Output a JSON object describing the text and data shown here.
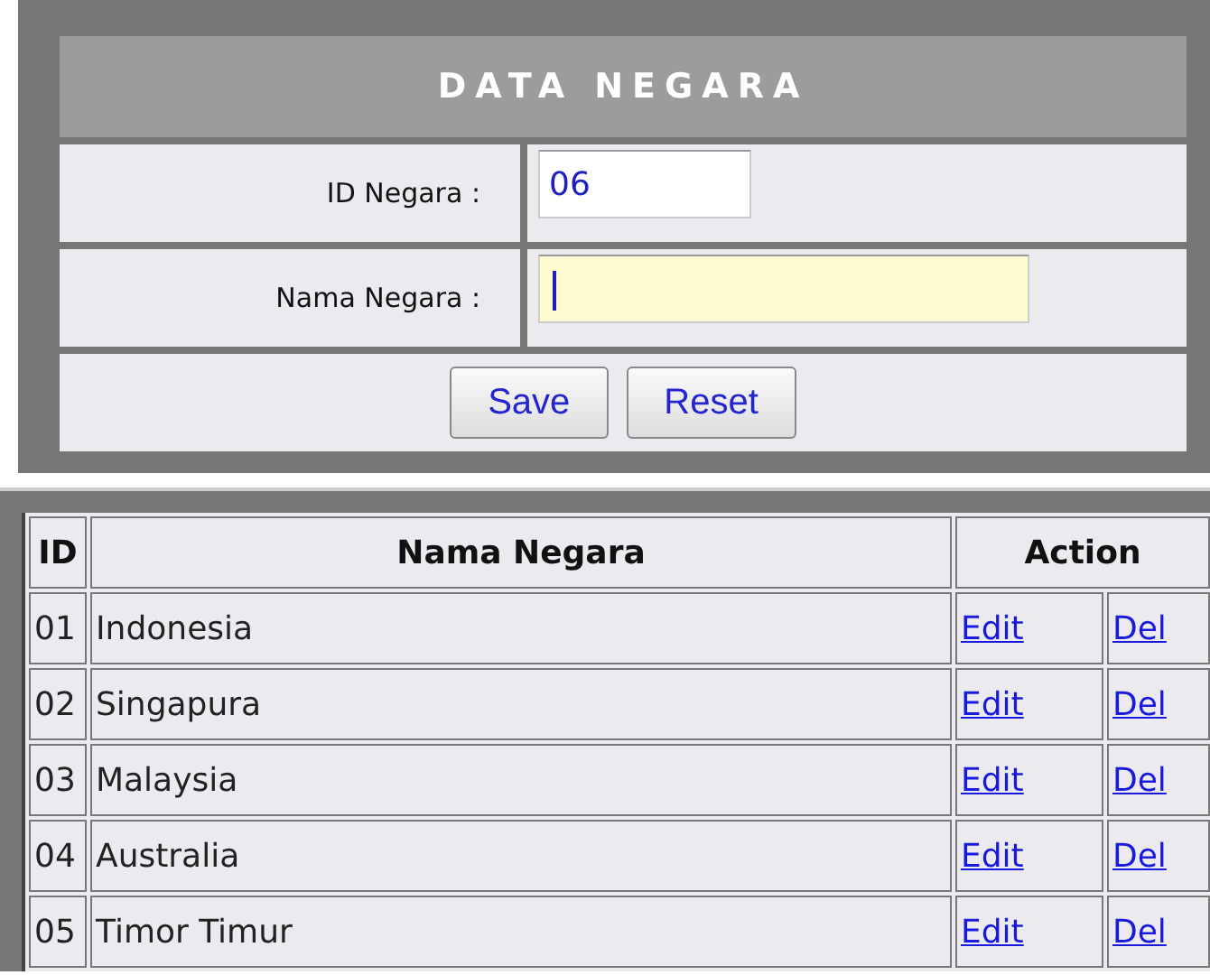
{
  "form": {
    "title": "DATA NEGARA",
    "fields": [
      {
        "label": "ID Negara :",
        "value": "06",
        "focused": false
      },
      {
        "label": "Nama Negara :",
        "focused": true
      }
    ],
    "buttons": [
      "Save",
      "Reset"
    ]
  },
  "table": {
    "columns": [
      "ID",
      "Nama Negara",
      "Action"
    ],
    "rows": [
      {
        "id": "01",
        "name": "Indonesia",
        "actions": [
          "Edit",
          "Del"
        ]
      },
      {
        "id": "02",
        "name": "Singapura",
        "actions": [
          "Edit",
          "Del"
        ]
      },
      {
        "id": "03",
        "name": "Malaysia",
        "actions": [
          "Edit",
          "Del"
        ]
      },
      {
        "id": "04",
        "name": "Australia",
        "actions": [
          "Edit",
          "Del"
        ]
      },
      {
        "id": "05",
        "name": "Timor Timur",
        "actions": [
          "Edit",
          "Del"
        ]
      }
    ]
  }
}
